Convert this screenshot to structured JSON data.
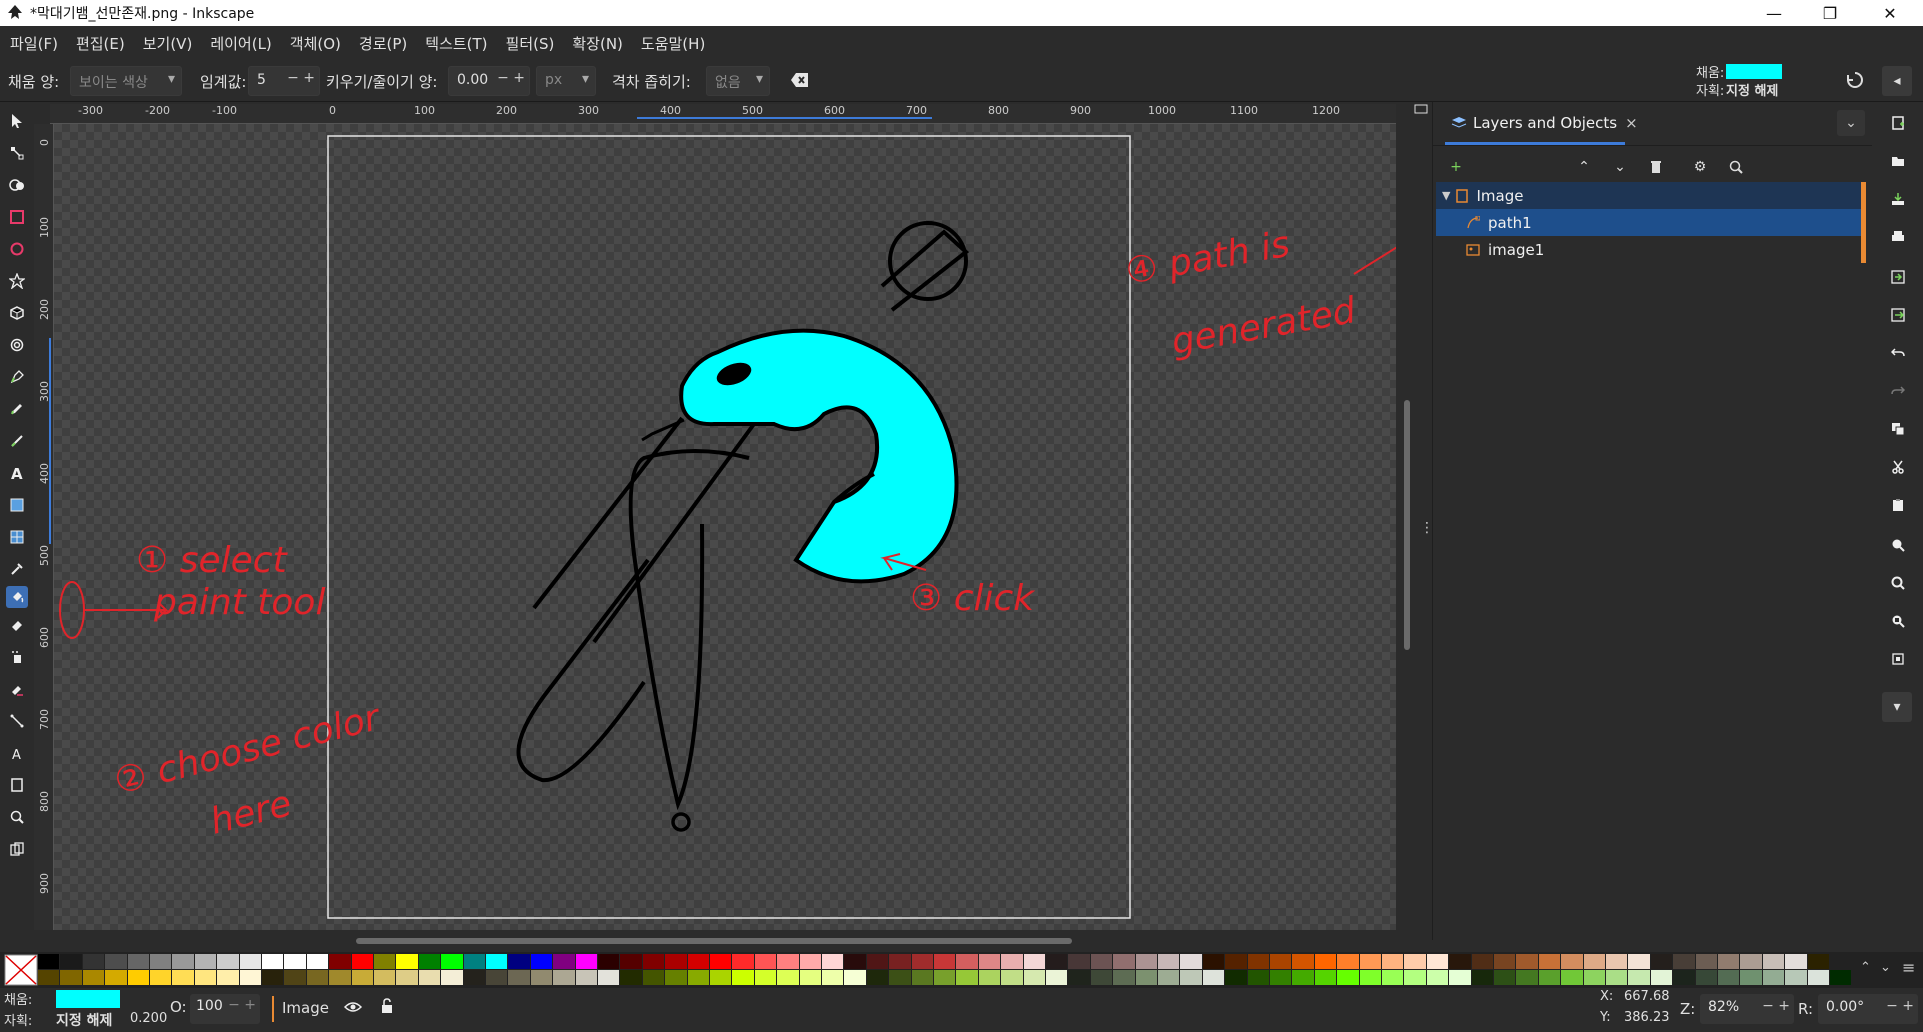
{
  "window": {
    "title": "*막대기뱀_선만존재.png - Inkscape",
    "minimize_glyph": "—",
    "maximize_glyph": "❐",
    "close_glyph": "✕"
  },
  "menu": [
    "파일(F)",
    "편집(E)",
    "보기(V)",
    "레이어(L)",
    "객체(O)",
    "경로(P)",
    "텍스트(T)",
    "필터(S)",
    "확장(N)",
    "도움말(H)"
  ],
  "tool_controls": {
    "fill_by_label": "채움 양:",
    "fill_by_value": "보이는 색상",
    "threshold_label": "임계값:",
    "threshold_value": "5",
    "grow_shrink_label": "키우기/줄이기 양:",
    "grow_shrink_value": "0.00",
    "unit_value": "px",
    "close_gaps_label": "격차 좁히기:",
    "close_gaps_value": "없음",
    "style_fill_label": "채움:",
    "style_stroke_label": "자획:",
    "style_stroke_value": "지정 해제",
    "fill_color": "#00ffff"
  },
  "ruler_ticks": [
    "-300",
    "-200",
    "-100",
    "0",
    "100",
    "200",
    "300",
    "400",
    "500",
    "600",
    "700",
    "800",
    "900",
    "1000",
    "1100",
    "1200"
  ],
  "ruler_v_ticks": [
    "0",
    "100",
    "200",
    "300",
    "400",
    "500",
    "600",
    "700",
    "800",
    "900"
  ],
  "annotations": {
    "select_paint_tool_1": "① select",
    "select_paint_tool_2": "paint tool",
    "choose_color_1": "② choose color",
    "choose_color_2": "here",
    "click": "③ click",
    "path_generated_1": "④ path is",
    "path_generated_2": "generated",
    "color": "#e0242a"
  },
  "panel": {
    "tab_label": "Layers and Objects",
    "tab_close": "×",
    "rows": [
      {
        "label": "Image",
        "type": "layer"
      },
      {
        "label": "path1",
        "type": "path"
      },
      {
        "label": "image1",
        "type": "image"
      }
    ]
  },
  "palette_colors_row1": [
    "#000000",
    "#1a1a1a",
    "#333333",
    "#4d4d4d",
    "#666666",
    "#808080",
    "#999999",
    "#b3b3b3",
    "#cccccc",
    "#e6e6e6",
    "#ffffff",
    "#ffffff",
    "#ffffff",
    "#800000",
    "#ff0000",
    "#808000",
    "#ffff00",
    "#008000",
    "#00ff00",
    "#008080",
    "#00ffff",
    "#000080",
    "#0000ff",
    "#800080",
    "#ff00ff",
    "#2b0000",
    "#550000",
    "#800000",
    "#aa0000",
    "#d40000",
    "#ff0000",
    "#ff2a2a",
    "#ff5555",
    "#ff8080",
    "#ffaaaa",
    "#ffd5d5",
    "#280b0b",
    "#501616",
    "#782121",
    "#a02c2c",
    "#c83737",
    "#d35f5f",
    "#de8787",
    "#e9afaf",
    "#f4d7d7",
    "#241c1c",
    "#483737",
    "#6c5353",
    "#916f6f",
    "#ac9393",
    "#c8b7b7",
    "#e3dbdb",
    "#2b1100",
    "#552200",
    "#803300",
    "#aa4400",
    "#d45500",
    "#ff6600",
    "#ff7f2a",
    "#ff9955",
    "#ffb380",
    "#ffccaa",
    "#ffe6d5",
    "#28170b",
    "#502d16",
    "#784421",
    "#a05a2c",
    "#c87137",
    "#d38d5f",
    "#deaa87",
    "#e9c6af",
    "#f4e3d7",
    "#241f1c",
    "#483e37",
    "#6c5d53",
    "#917c6f",
    "#ac9d93",
    "#c8beb7",
    "#e3dedb",
    "#2b2200"
  ],
  "palette_colors_row2": [
    "#554400",
    "#806600",
    "#aa8800",
    "#d4aa00",
    "#ffcc00",
    "#ffd42a",
    "#ffdd55",
    "#ffe680",
    "#ffeeaa",
    "#fff6d5",
    "#28220b",
    "#504416",
    "#786721",
    "#a0892c",
    "#c8ab37",
    "#d3bc5f",
    "#decd87",
    "#e9ddaf",
    "#f4eed7",
    "#24221c",
    "#484537",
    "#6c6753",
    "#918a6f",
    "#aca793",
    "#c8c4b7",
    "#e3e2db",
    "#222b00",
    "#445500",
    "#668000",
    "#88aa00",
    "#aad400",
    "#ccff00",
    "#d4ff2a",
    "#ddff55",
    "#e5ff80",
    "#eeffaa",
    "#f6ffd5",
    "#1e280b",
    "#3c5016",
    "#5a7821",
    "#78a02c",
    "#96c837",
    "#abd35f",
    "#c1de87",
    "#d6e9af",
    "#ebf4d7",
    "#1f241c",
    "#3e4837",
    "#5d6c53",
    "#7c916f",
    "#9dac93",
    "#bec8b7",
    "#dee3db",
    "#112b00",
    "#225500",
    "#338000",
    "#44aa00",
    "#55d400",
    "#66ff00",
    "#7fff2a",
    "#99ff55",
    "#b3ff80",
    "#ccffaa",
    "#e5ffd5",
    "#17280b",
    "#2d5016",
    "#447821",
    "#5aa02c",
    "#71c837",
    "#8dd35f",
    "#aade87",
    "#c6e9af",
    "#e3f4d7",
    "#1c241c",
    "#374837",
    "#536c53",
    "#6f916f",
    "#93ac93",
    "#b7c8b7",
    "#dbe3db",
    "#002b00"
  ],
  "status": {
    "fill_label": "채움:",
    "stroke_label": "자획:",
    "stroke_value": "지정 해제",
    "stroke_width": "0.200",
    "opacity_label": "O:",
    "opacity_value": "100",
    "layer_name": "Image",
    "x_label": "X:",
    "x_value": "667.68",
    "y_label": "Y:",
    "y_value": "386.23",
    "zoom_label": "Z:",
    "zoom_value": "82%",
    "rotate_label": "R:",
    "rotate_value": "0.00°"
  }
}
